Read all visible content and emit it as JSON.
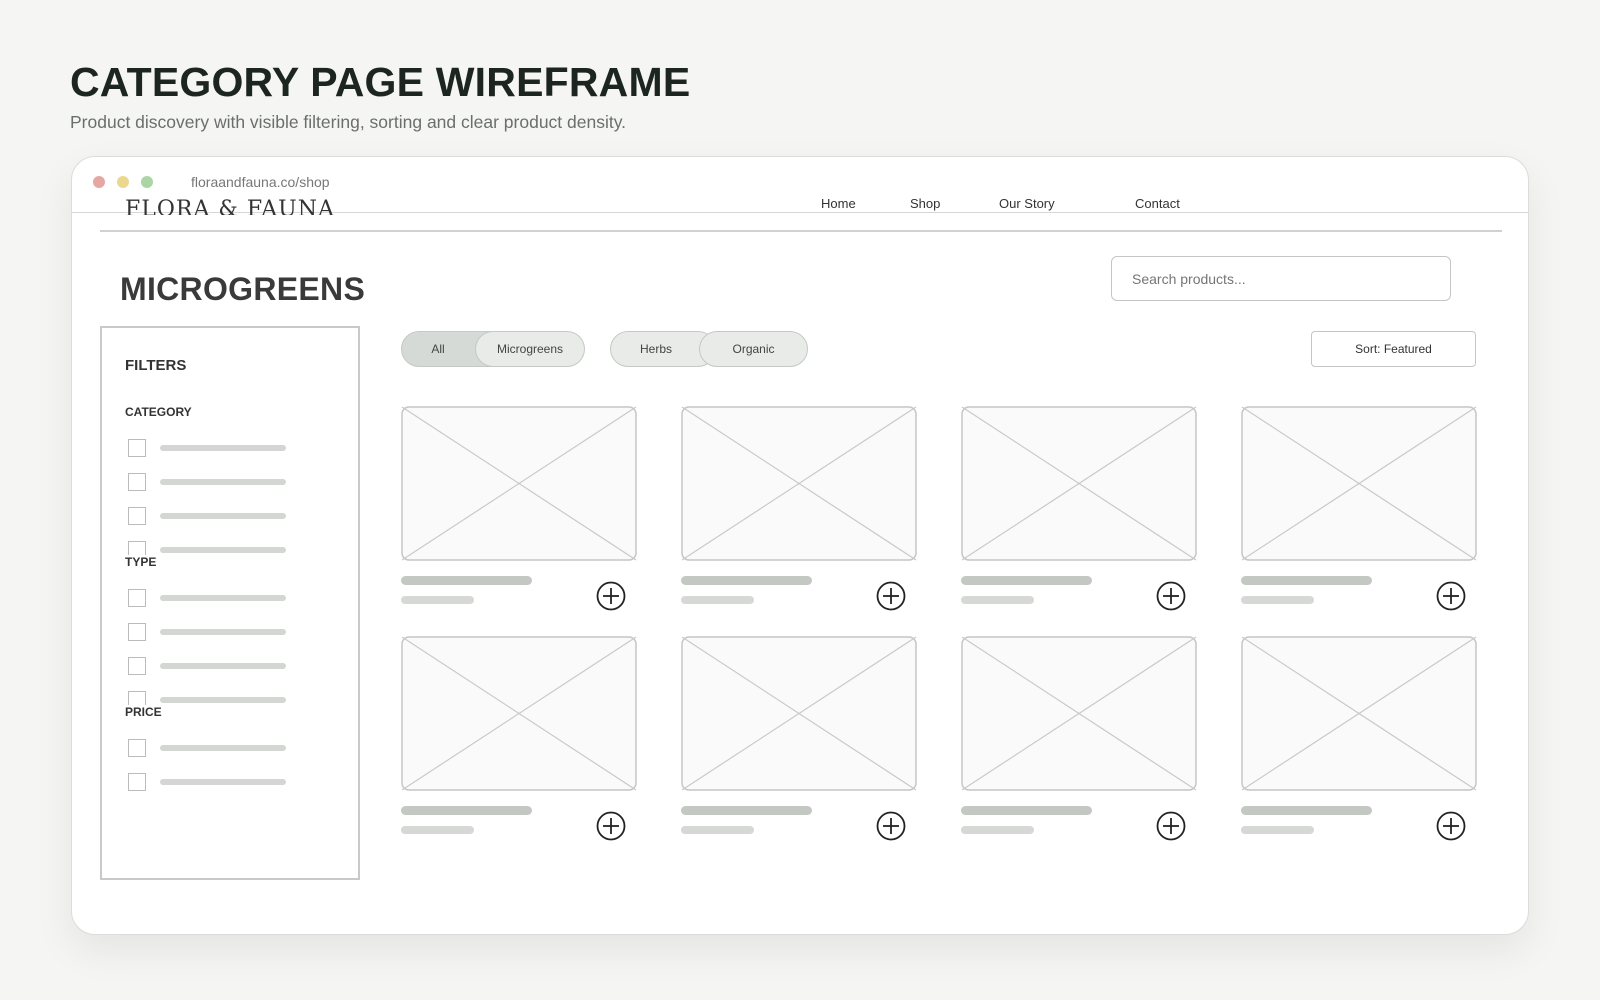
{
  "header": {
    "title": "CATEGORY PAGE WIREFRAME",
    "subtitle": "Product discovery with visible filtering, sorting and clear product density."
  },
  "browser": {
    "url": "floraandfauna.co/shop"
  },
  "site": {
    "logo": "FLORA & FAUNA",
    "nav": [
      "Home",
      "Shop",
      "Our Story",
      "Contact"
    ]
  },
  "category": {
    "title": "MICROGREENS"
  },
  "search": {
    "placeholder": "Search products..."
  },
  "filters": {
    "title": "FILTERS",
    "groups": [
      {
        "label": "CATEGORY",
        "options": 4
      },
      {
        "label": "TYPE",
        "options": 4
      },
      {
        "label": "PRICE",
        "options": 2
      }
    ]
  },
  "chips": [
    {
      "label": "All",
      "state": "active"
    },
    {
      "label": "Microgreens",
      "state": "light"
    },
    {
      "label": "Herbs",
      "state": "light"
    },
    {
      "label": "Organic",
      "state": "light"
    }
  ],
  "sort": {
    "label": "Sort: Featured"
  },
  "products": {
    "count": 8
  },
  "colors": {
    "background": "#f5f5f3",
    "title": "#1d2520",
    "dot_red": "#e6a7a2",
    "dot_yellow": "#ecd78e",
    "dot_green": "#a9d6a3",
    "chip_active": "#d6dad6",
    "chip_light": "#e8ebe7",
    "placeholder_line": "#c4c8c3"
  }
}
